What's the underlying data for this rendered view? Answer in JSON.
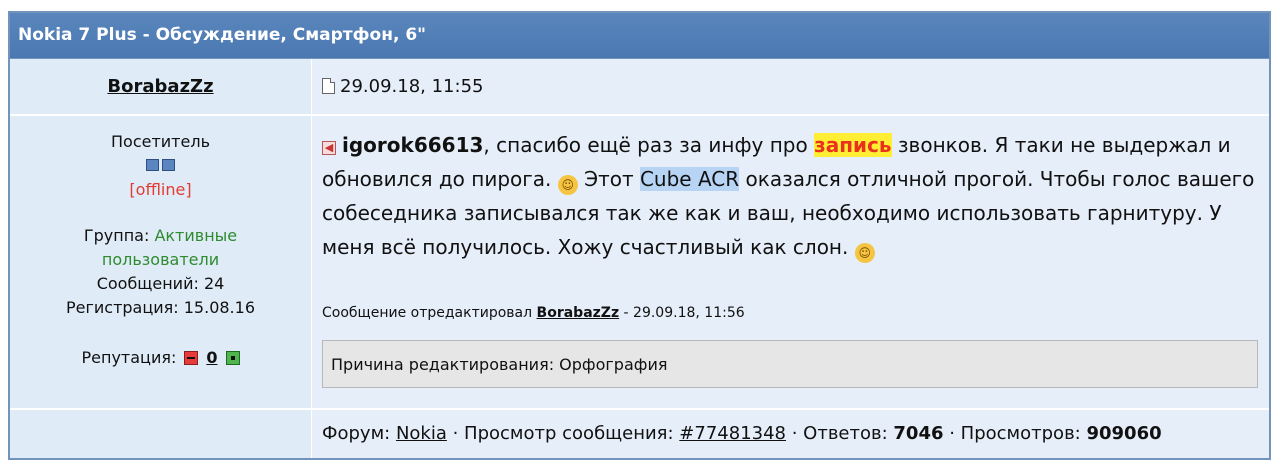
{
  "topic_title": "Nokia 7 Plus - Обсуждение, Смартфон, 6\"",
  "author": "BorabazZz",
  "post_date": "29.09.18, 11:55",
  "user": {
    "rank": "Посетитель",
    "status": "[offline]",
    "group_label": "Группа:",
    "group_value_1": "Активные",
    "group_value_2": "пользователи",
    "messages": "Сообщений: 24",
    "registration": "Регистрация: 15.08.16",
    "reputation_label": "Репутация:",
    "reputation_value": "0"
  },
  "post": {
    "mention": "igorok66613",
    "text_1": ", спасибо ещё раз за инфу про ",
    "highlight_1": "запись",
    "text_2": " звонков. Я таки не выдержал и обновился до пирога. ",
    "text_3": " Этот ",
    "highlight_2": "Cube ACR",
    "text_4": " оказался отличной прогой. Чтобы голос вашего собеседника записывался так же как и ваш, необходимо использовать гарнитуру. У меня всё получилось. Хожу счастливый как слон. "
  },
  "edit": {
    "prefix": "Сообщение отредактировал ",
    "editor": "BorabazZz",
    "suffix": " - 29.09.18, 11:56",
    "reason": "Причина редактирования: Орфография"
  },
  "footer": {
    "forum_label": "Форум: ",
    "forum_name": "Nokia",
    "view_label": " · Просмотр сообщения: ",
    "message_id": "#77481348",
    "replies_label": " · Ответов: ",
    "replies": "7046",
    "views_label": " · Просмотров: ",
    "views": "909060"
  },
  "icons": [
    "document-icon",
    "rank-icon",
    "quote-icon",
    "rolling-laugh-emoji-icon",
    "grin-emoji-icon",
    "reputation-minus-icon",
    "reputation-plus-icon"
  ]
}
